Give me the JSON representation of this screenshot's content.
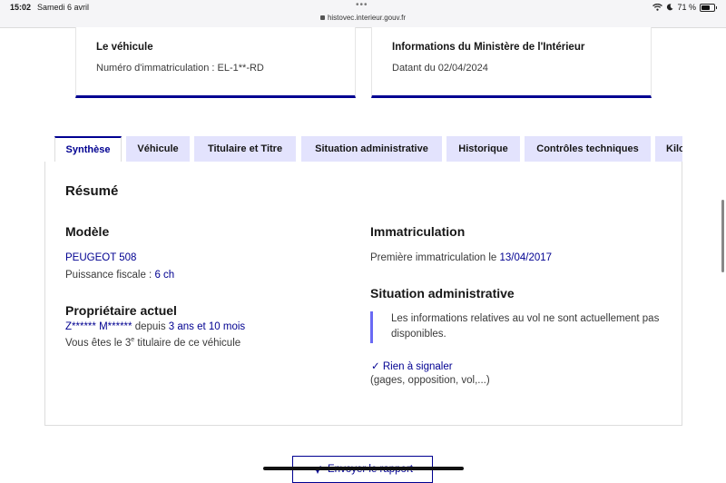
{
  "status_bar": {
    "time": "15:02",
    "date": "Samedi 6 avril",
    "url": "histovec.interieur.gouv.fr",
    "battery": "71 %",
    "battery_level": 0.71
  },
  "cards": {
    "vehicle": {
      "title": "Le véhicule",
      "text": "Numéro d'immatriculation : EL-1**-RD"
    },
    "ministry": {
      "title": "Informations du Ministère de l'Intérieur",
      "text": "Datant du 02/04/2024"
    }
  },
  "tabs": [
    {
      "label": "Synthèse",
      "active": true
    },
    {
      "label": "Véhicule",
      "active": false
    },
    {
      "label": "Titulaire et Titre",
      "active": false
    },
    {
      "label": "Situation administrative",
      "active": false
    },
    {
      "label": "Historique",
      "active": false
    },
    {
      "label": "Contrôles techniques",
      "active": false
    },
    {
      "label": "Kilo",
      "active": false
    }
  ],
  "summary": {
    "title": "Résumé",
    "modele": {
      "heading": "Modèle",
      "value": "PEUGEOT 508",
      "puissance_label": "Puissance fiscale : ",
      "puissance_value": "6 ch"
    },
    "proprietaire": {
      "heading": "Propriétaire actuel",
      "name": "Z****** M******",
      "depuis": " depuis ",
      "duration": "3 ans et 10 mois",
      "titulaire_prefix": "Vous êtes le 3",
      "titulaire_sup": "e",
      "titulaire_suffix": " titulaire de ce véhicule"
    },
    "immatriculation": {
      "heading": "Immatriculation",
      "label": "Première immatriculation le ",
      "date": "13/04/2017"
    },
    "situation": {
      "heading": "Situation administrative",
      "notice": "Les informations relatives au vol ne sont actuellement pas disponibles.",
      "rien": "Rien à signaler",
      "details": "(gages, opposition, vol,...)"
    }
  },
  "actions": {
    "send_report": "Envoyer le rapport"
  },
  "colors": {
    "accent": "#000091",
    "tab_bg": "#e3e3fd",
    "notice_bar": "#6a6af4"
  }
}
